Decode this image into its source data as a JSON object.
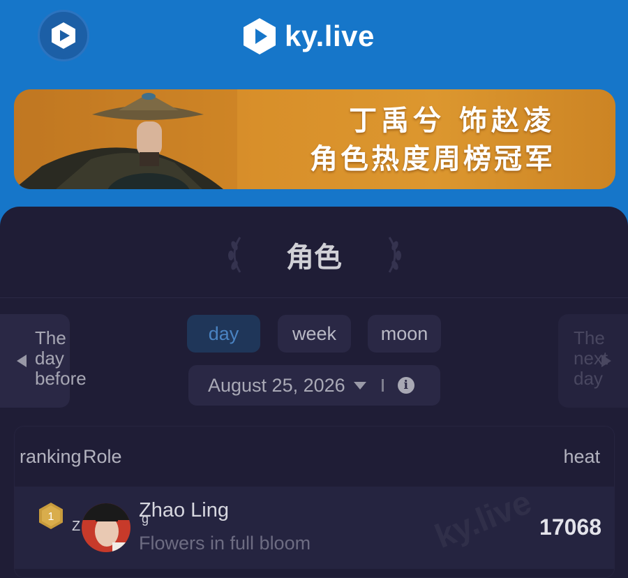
{
  "header": {
    "brand": "ky.live",
    "menu_icon": "play-hex-icon",
    "logo_icon": "ky-logo-icon"
  },
  "banner": {
    "line1": "丁禹兮 饰赵凌",
    "line2": "角色热度周榜冠军"
  },
  "panel": {
    "title": "角色"
  },
  "nav": {
    "prev_label": "The day before",
    "next_label": "The next day",
    "tabs": [
      {
        "label": "day",
        "active": true
      },
      {
        "label": "week",
        "active": false
      },
      {
        "label": "moon",
        "active": false
      }
    ],
    "date": "August 25, 2026"
  },
  "table": {
    "col_ranking": "ranking",
    "col_role": "Role",
    "col_heat": "heat",
    "rows": [
      {
        "rank": "1",
        "avatar_alt": "Z",
        "avatar_alt_tail": "g",
        "name": "Zhao Ling",
        "work": "Flowers in full bloom",
        "heat": "17068"
      }
    ]
  },
  "watermark": "ky.live",
  "colors": {
    "header_bg": "#1676c9",
    "panel_bg": "#1f1d36",
    "active_tab_text": "#4a83c2",
    "rank_gold": "#c89b3c"
  }
}
